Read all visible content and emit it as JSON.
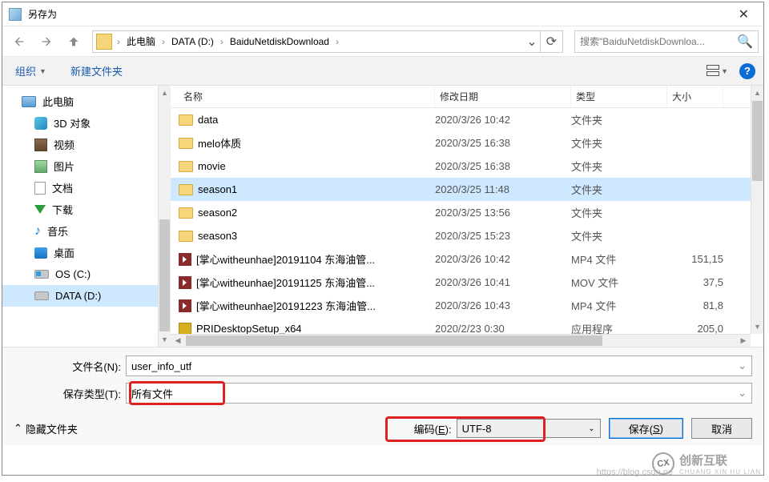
{
  "titlebar": {
    "title": "另存为"
  },
  "breadcrumb": {
    "seg1": "此电脑",
    "seg2": "DATA (D:)",
    "seg3": "BaiduNetdiskDownload"
  },
  "search": {
    "placeholder": "搜索\"BaiduNetdiskDownloa..."
  },
  "toolbar": {
    "organize": "组织",
    "new_folder": "新建文件夹"
  },
  "sidebar": {
    "items": [
      {
        "label": "此电脑"
      },
      {
        "label": "3D 对象"
      },
      {
        "label": "视频"
      },
      {
        "label": "图片"
      },
      {
        "label": "文档"
      },
      {
        "label": "下载"
      },
      {
        "label": "音乐"
      },
      {
        "label": "桌面"
      },
      {
        "label": "OS (C:)"
      },
      {
        "label": "DATA (D:)"
      }
    ]
  },
  "columns": {
    "name": "名称",
    "date": "修改日期",
    "type": "类型",
    "size": "大小"
  },
  "files": [
    {
      "name": "data",
      "date": "2020/3/26 10:42",
      "type": "文件夹",
      "size": "",
      "icon": "folder"
    },
    {
      "name": "melo体质",
      "date": "2020/3/25 16:38",
      "type": "文件夹",
      "size": "",
      "icon": "folder"
    },
    {
      "name": "movie",
      "date": "2020/3/25 16:38",
      "type": "文件夹",
      "size": "",
      "icon": "folder"
    },
    {
      "name": "season1",
      "date": "2020/3/25 11:48",
      "type": "文件夹",
      "size": "",
      "icon": "folder",
      "selected": true
    },
    {
      "name": "season2",
      "date": "2020/3/25 13:56",
      "type": "文件夹",
      "size": "",
      "icon": "folder"
    },
    {
      "name": "season3",
      "date": "2020/3/25 15:23",
      "type": "文件夹",
      "size": "",
      "icon": "folder"
    },
    {
      "name": "[掌心witheunhae]20191104 东海油管...",
      "date": "2020/3/26 10:42",
      "type": "MP4 文件",
      "size": "151,15",
      "icon": "mp4"
    },
    {
      "name": "[掌心witheunhae]20191125 东海油管...",
      "date": "2020/3/26 10:41",
      "type": "MOV 文件",
      "size": "37,5",
      "icon": "mp4"
    },
    {
      "name": "[掌心witheunhae]20191223 东海油管...",
      "date": "2020/3/26 10:43",
      "type": "MP4 文件",
      "size": "81,8",
      "icon": "mp4"
    },
    {
      "name": "PRIDesktopSetup_x64",
      "date": "2020/2/23 0:30",
      "type": "应用程序",
      "size": "205,0",
      "icon": "exe"
    }
  ],
  "footer": {
    "filename_label": "文件名(N):",
    "filename_value": "user_info_utf",
    "savetype_label": "保存类型(T):",
    "savetype_value": "所有文件",
    "hide_folders": "隐藏文件夹",
    "encoding_label": "编码(E):",
    "encoding_value": "UTF-8",
    "save_btn": "保存(S)",
    "cancel_btn": "取消"
  },
  "watermark": {
    "text": "创新互联",
    "sub": "CHUANG XIN HU LIAN",
    "url": "https://blog.csdn.ne"
  }
}
